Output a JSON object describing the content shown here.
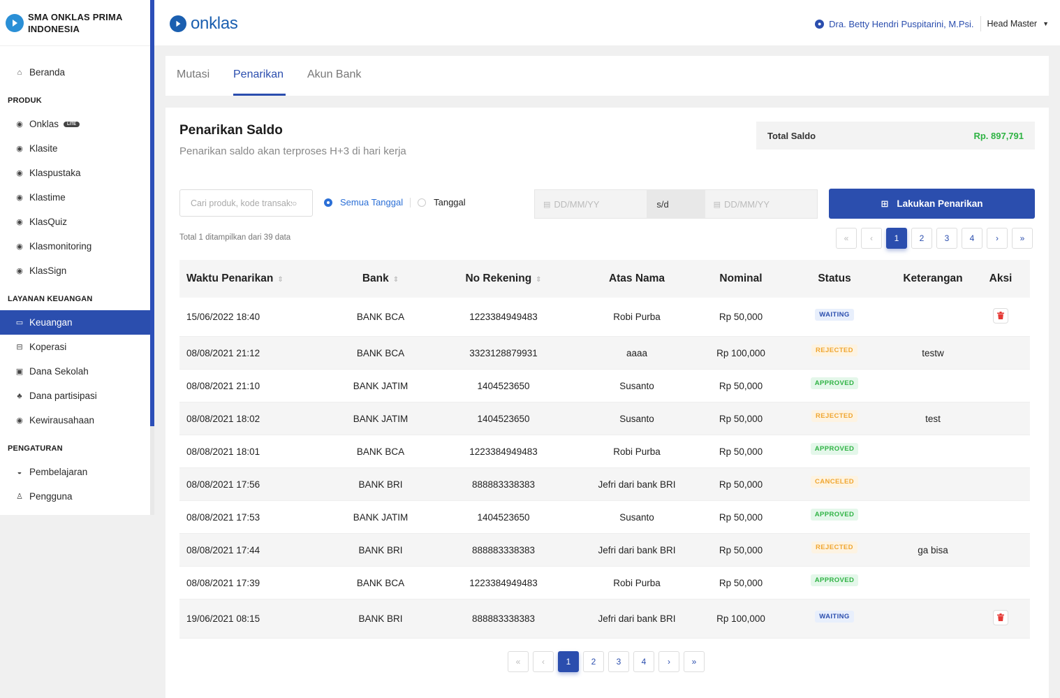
{
  "sidebar": {
    "school_name": "SMA ONKLAS PRIMA INDONESIA",
    "beranda": "Beranda",
    "section_produk": "PRODUK",
    "produk": [
      {
        "label": "Onklas",
        "icon": "onklas-icon",
        "badge": "LITE"
      },
      {
        "label": "Klasite",
        "icon": "klasite-icon"
      },
      {
        "label": "Klaspustaka",
        "icon": "klaspustaka-icon"
      },
      {
        "label": "Klastime",
        "icon": "klastime-icon"
      },
      {
        "label": "KlasQuiz",
        "icon": "klasquiz-icon"
      },
      {
        "label": "Klasmonitoring",
        "icon": "klasmonitoring-icon"
      },
      {
        "label": "KlasSign",
        "icon": "klassign-icon"
      }
    ],
    "section_keuangan": "LAYANAN KEUANGAN",
    "keuangan": [
      {
        "label": "Keuangan",
        "icon": "wallet-icon"
      },
      {
        "label": "Koperasi",
        "icon": "koperasi-icon"
      },
      {
        "label": "Dana Sekolah",
        "icon": "dana-sekolah-icon"
      },
      {
        "label": "Dana partisipasi",
        "icon": "dana-partisipasi-icon"
      },
      {
        "label": "Kewirausahaan",
        "icon": "kewirausahaan-icon"
      }
    ],
    "section_pengaturan": "PENGATURAN",
    "pengaturan": [
      {
        "label": "Pembelajaran",
        "icon": "pembelajaran-icon"
      },
      {
        "label": "Pengguna",
        "icon": "user-icon"
      }
    ]
  },
  "header": {
    "brand": "onklas",
    "user_name": "Dra. Betty Hendri Puspitarini, M.Psi.",
    "user_role": "Head Master"
  },
  "tabs": [
    {
      "label": "Mutasi"
    },
    {
      "label": "Penarikan"
    },
    {
      "label": "Akun Bank"
    }
  ],
  "main": {
    "title": "Penarikan Saldo",
    "subtitle": "Penarikan saldo akan terproses H+3 di hari kerja",
    "saldo_label": "Total Saldo",
    "saldo_value": "Rp. 897,791",
    "search_placeholder": "Cari produk, kode transaksi",
    "radio_all": "Semua Tanggal",
    "radio_date": "Tanggal",
    "date_from_placeholder": "DD/MM/YY",
    "date_sep": "s/d",
    "date_to_placeholder": "DD/MM/YY",
    "withdraw_button": "Lakukan Penarikan",
    "count_text": "Total 1 ditampilkan dari 39 data",
    "pages": [
      "«",
      "‹",
      "1",
      "2",
      "3",
      "4",
      "›",
      "»"
    ],
    "active_page": "1"
  },
  "table": {
    "headers": [
      "Waktu Penarikan",
      "Bank",
      "No Rekening",
      "Atas Nama",
      "Nominal",
      "Status",
      "Keterangan",
      "Aksi"
    ],
    "rows": [
      {
        "time": "15/06/2022 18:40",
        "bank": "BANK BCA",
        "account": "1223384949483",
        "name": "Robi Purba",
        "amount": "Rp 50,000",
        "status": "WAITING",
        "note": "",
        "delete": true
      },
      {
        "time": "08/08/2021 21:12",
        "bank": "BANK BCA",
        "account": "3323128879931",
        "name": "aaaa",
        "amount": "Rp 100,000",
        "status": "REJECTED",
        "note": "testw",
        "delete": false
      },
      {
        "time": "08/08/2021 21:10",
        "bank": "BANK JATIM",
        "account": "1404523650",
        "name": "Susanto",
        "amount": "Rp 50,000",
        "status": "APPROVED",
        "note": "",
        "delete": false
      },
      {
        "time": "08/08/2021 18:02",
        "bank": "BANK JATIM",
        "account": "1404523650",
        "name": "Susanto",
        "amount": "Rp 50,000",
        "status": "REJECTED",
        "note": "test",
        "delete": false
      },
      {
        "time": "08/08/2021 18:01",
        "bank": "BANK BCA",
        "account": "1223384949483",
        "name": "Robi Purba",
        "amount": "Rp 50,000",
        "status": "APPROVED",
        "note": "",
        "delete": false
      },
      {
        "time": "08/08/2021 17:56",
        "bank": "BANK BRI",
        "account": "888883338383",
        "name": "Jefri dari bank BRI",
        "amount": "Rp 50,000",
        "status": "CANCELED",
        "note": "",
        "delete": false
      },
      {
        "time": "08/08/2021 17:53",
        "bank": "BANK JATIM",
        "account": "1404523650",
        "name": "Susanto",
        "amount": "Rp 50,000",
        "status": "APPROVED",
        "note": "",
        "delete": false
      },
      {
        "time": "08/08/2021 17:44",
        "bank": "BANK BRI",
        "account": "888883338383",
        "name": "Jefri dari bank BRI",
        "amount": "Rp 50,000",
        "status": "REJECTED",
        "note": "ga bisa",
        "delete": false
      },
      {
        "time": "08/08/2021 17:39",
        "bank": "BANK BCA",
        "account": "1223384949483",
        "name": "Robi Purba",
        "amount": "Rp 50,000",
        "status": "APPROVED",
        "note": "",
        "delete": false
      },
      {
        "time": "19/06/2021 08:15",
        "bank": "BANK BRI",
        "account": "888883338383",
        "name": "Jefri dari bank BRI",
        "amount": "Rp 100,000",
        "status": "WAITING",
        "note": "",
        "delete": true
      }
    ]
  },
  "colors": {
    "primary": "#2b4eae",
    "approved": "#2fb344",
    "rejected": "#f0a630",
    "delete": "#e53935"
  }
}
